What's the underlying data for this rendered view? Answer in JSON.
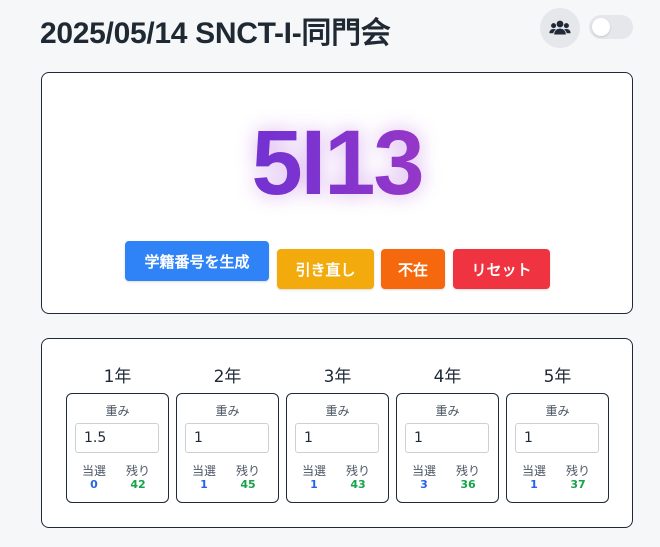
{
  "header": {
    "title": "2025/05/14 SNCT-I-同門会"
  },
  "draw": {
    "student_number": "5I13",
    "buttons": {
      "generate": "学籍番号を生成",
      "redraw": "引き直し",
      "absent": "不在",
      "reset": "リセット"
    }
  },
  "grades": [
    {
      "label": "1年",
      "weight_label": "重み",
      "weight": "1.5",
      "elected_label": "当選",
      "elected": "0",
      "remaining_label": "残り",
      "remaining": "42"
    },
    {
      "label": "2年",
      "weight_label": "重み",
      "weight": "1",
      "elected_label": "当選",
      "elected": "1",
      "remaining_label": "残り",
      "remaining": "45"
    },
    {
      "label": "3年",
      "weight_label": "重み",
      "weight": "1",
      "elected_label": "当選",
      "elected": "1",
      "remaining_label": "残り",
      "remaining": "43"
    },
    {
      "label": "4年",
      "weight_label": "重み",
      "weight": "1",
      "elected_label": "当選",
      "elected": "3",
      "remaining_label": "残り",
      "remaining": "36"
    },
    {
      "label": "5年",
      "weight_label": "重み",
      "weight": "1",
      "elected_label": "当選",
      "elected": "1",
      "remaining_label": "残り",
      "remaining": "37"
    }
  ],
  "icons": {
    "members": "users-icon"
  },
  "colors": {
    "generate": "#2f83f7",
    "redraw": "#f2aa0c",
    "absent": "#f6680d",
    "reset": "#ef3340",
    "elected": "#2563eb",
    "remaining": "#16a34a"
  }
}
